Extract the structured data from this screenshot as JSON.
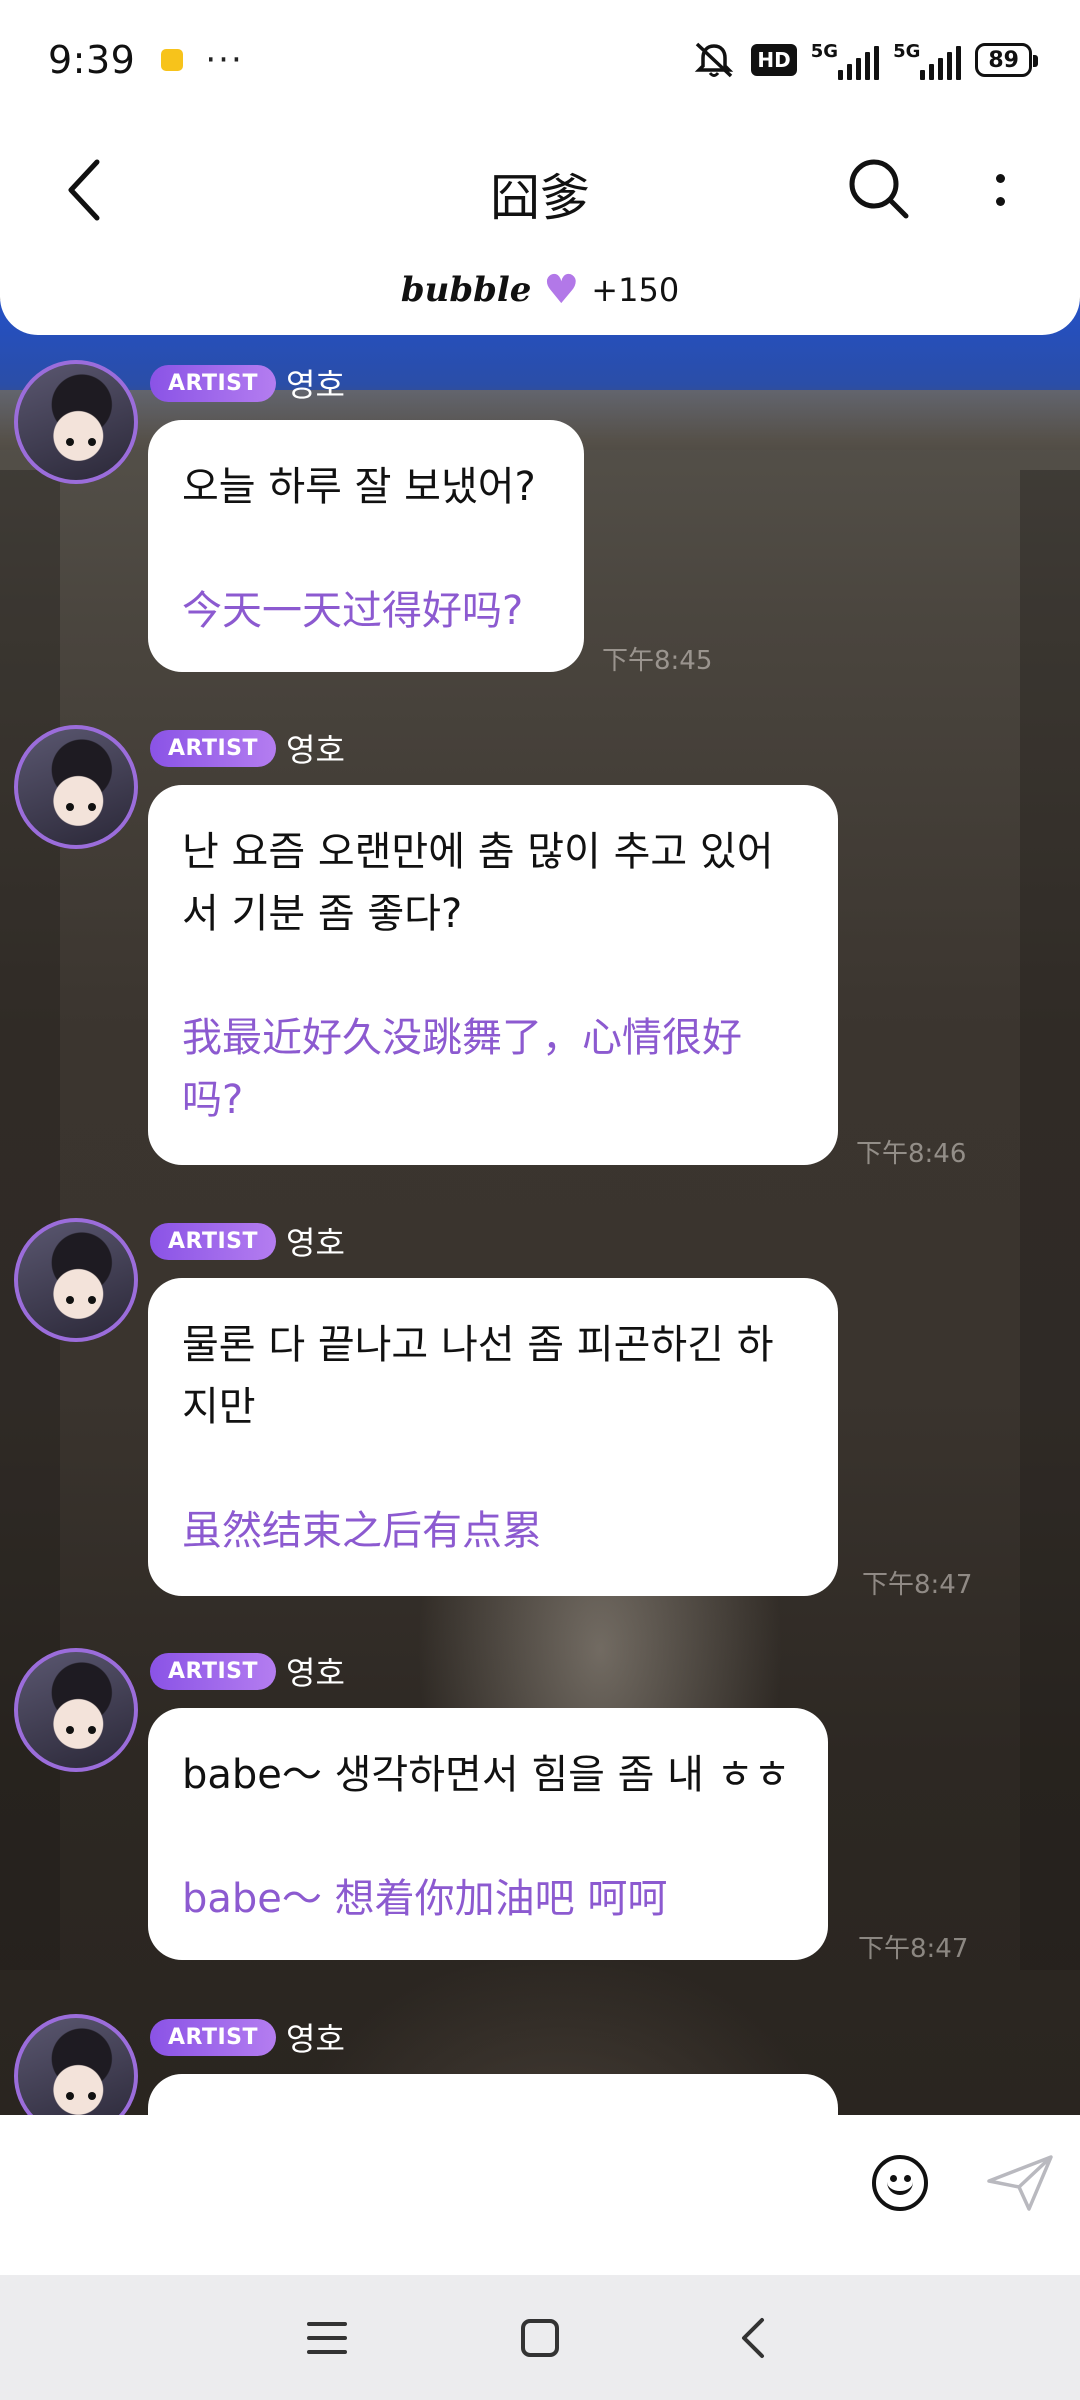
{
  "status_bar": {
    "time": "9:39",
    "more": "···",
    "hd": "HD",
    "network_1": "5G",
    "network_2": "5G",
    "battery": "89"
  },
  "header": {
    "title": "囧爹",
    "bubble_logo": "bubble",
    "bubble_count": "+150"
  },
  "messages": [
    {
      "badge": "ARTIST",
      "sender": "영호",
      "ko": "오늘 하루 잘 보냈어?",
      "zh": "今天一天过得好吗?",
      "time": "下午8:45"
    },
    {
      "badge": "ARTIST",
      "sender": "영호",
      "ko": "난 요즘 오랜만에 춤 많이 추고 있어\n서 기분 좀 좋다?",
      "zh": "我最近好久没跳舞了，心情很好\n吗?",
      "time": "下午8:46"
    },
    {
      "badge": "ARTIST",
      "sender": "영호",
      "ko": "물론 다 끝나고 나선 좀 피곤하긴 하\n지만",
      "zh": "虽然结束之后有点累",
      "time": "下午8:47"
    },
    {
      "badge": "ARTIST",
      "sender": "영호",
      "ko": "babe～ 생각하면서 힘을 좀 내 ㅎㅎ",
      "zh": "babe～ 想着你加油吧 呵呵",
      "time": "下午8:47"
    },
    {
      "badge": "ARTIST",
      "sender": "영호"
    }
  ],
  "input": {
    "placeholder": ""
  },
  "icons": {
    "back": "back-arrow-icon",
    "search": "search-icon",
    "menu": "more-vertical-icon",
    "heart": "heart-icon",
    "emoji": "emoji-icon",
    "send": "send-icon",
    "nav_menu": "menu-icon",
    "nav_home": "home-icon",
    "nav_back": "back-icon"
  },
  "colors": {
    "accent": "#8c5ad0",
    "badge": "#9b62e8"
  }
}
